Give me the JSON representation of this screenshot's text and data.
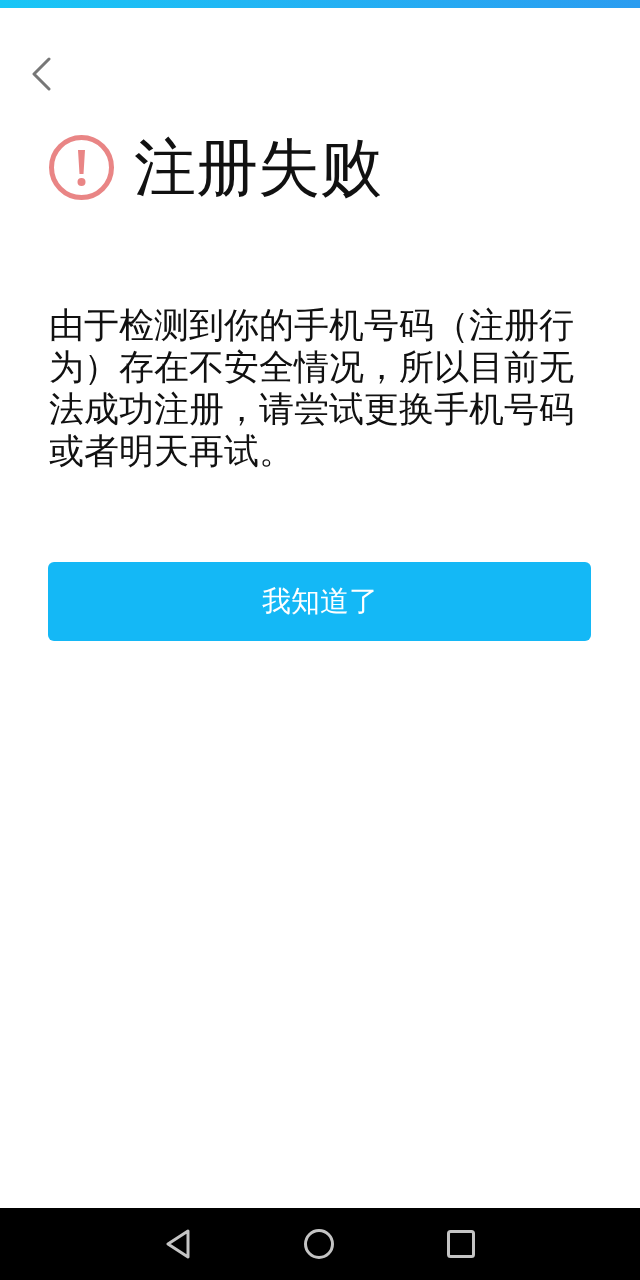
{
  "header": {
    "title": "注册失败"
  },
  "message": "由于检测到你的手机号码（注册行为）存在不安全情况，所以目前无法成功注册，请尝试更换手机号码或者明天再试。",
  "button": {
    "label": "我知道了"
  },
  "nav_bar": {
    "buttons": [
      {
        "kind": "back"
      },
      {
        "kind": "home"
      },
      {
        "kind": "recents"
      }
    ]
  }
}
